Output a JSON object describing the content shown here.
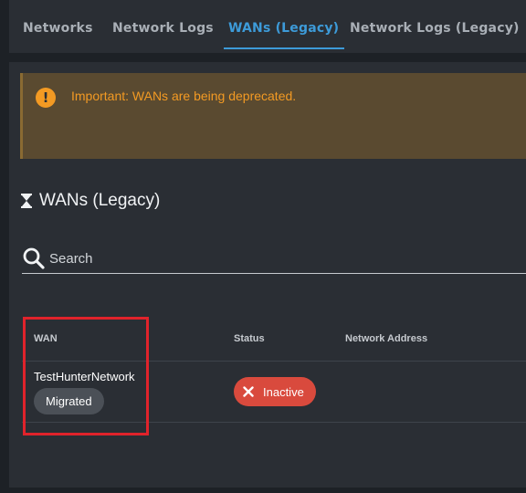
{
  "tabs": [
    {
      "label": "Networks",
      "active": false
    },
    {
      "label": "Network Logs",
      "active": false
    },
    {
      "label": "WANs (Legacy)",
      "active": true
    },
    {
      "label": "Network Logs (Legacy)",
      "active": false
    }
  ],
  "alert": {
    "icon": "exclamation-icon",
    "text": "Important: WANs are being deprecated."
  },
  "section": {
    "icon": "hourglass-icon",
    "title": "WANs (Legacy)"
  },
  "search": {
    "placeholder": "Search",
    "value": ""
  },
  "table": {
    "columns": [
      "WAN",
      "Status",
      "Network Address"
    ],
    "rows": [
      {
        "wan": "TestHunterNetwork",
        "badge": "Migrated",
        "status": "Inactive",
        "network_address": ""
      }
    ]
  },
  "colors": {
    "accent": "#3d9bd9",
    "warning": "#f39a23",
    "inactive": "#d94a3d",
    "highlight": "#e0232b"
  }
}
